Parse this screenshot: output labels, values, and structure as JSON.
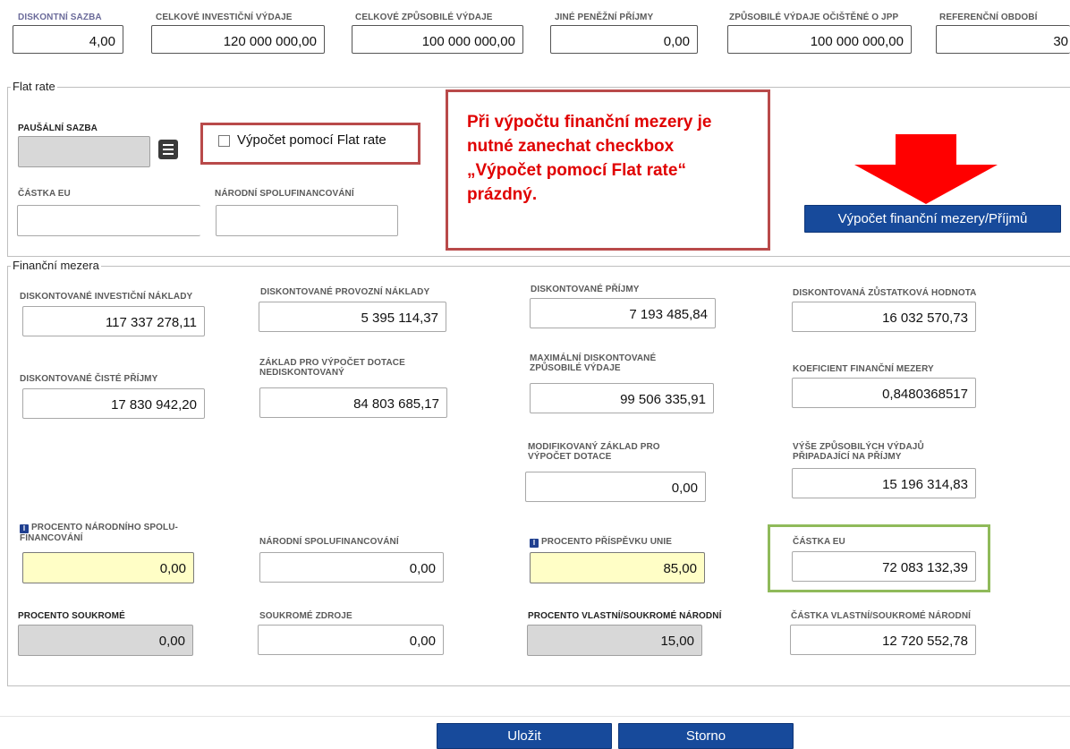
{
  "top": {
    "fields": [
      {
        "label": "DISKONTNÍ SAZBA",
        "value": "4,00"
      },
      {
        "label": "CELKOVÉ INVESTIČNÍ VÝDAJE",
        "value": "120 000 000,00"
      },
      {
        "label": "CELKOVÉ ZPŮSOBILÉ VÝDAJE",
        "value": "100 000 000,00"
      },
      {
        "label": "JINÉ PENĚŽNÍ PŘÍJMY",
        "value": "0,00"
      },
      {
        "label": "ZPŮSOBILÉ VÝDAJE OČIŠTĚNÉ O JPP",
        "value": "100 000 000,00"
      },
      {
        "label": "REFERENČNÍ OBDOBÍ",
        "value": "30"
      }
    ]
  },
  "flat_rate": {
    "title": "Flat rate",
    "pausalni_sazba_label": "PAUŠÁLNÍ SAZBA",
    "pausalni_sazba_value": "",
    "checkbox_label": "Výpočet pomocí Flat rate",
    "castka_eu_label": "ČÁSTKA EU",
    "castka_eu_value": "",
    "narodni_label": "NÁRODNÍ SPOLUFINANCOVÁNÍ",
    "narodni_value": "",
    "calc_button": "Výpočet finanční mezery/Příjmů"
  },
  "annotation": {
    "text": "Při výpočtu finanční mezery je nutné zanechat checkbox „Výpočet pomocí Flat rate“ prázdný.",
    "color": "#e00000",
    "arrow_color": "#ff0000"
  },
  "financni_mezera": {
    "title": "Finanční mezera",
    "disk_invest_label": "DISKONTOVANÉ INVESTIČNÍ NÁKLADY",
    "disk_invest_value": "117 337 278,11",
    "disk_provoz_label": "DISKONTOVANÉ PROVOZNÍ NÁKLADY",
    "disk_provoz_value": "5 395 114,37",
    "disk_prijmy_label": "DISKONTOVANÉ PŘÍJMY",
    "disk_prijmy_value": "7 193 485,84",
    "disk_zustatkova_label": "DISKONTOVANÁ ZŮSTATKOVÁ HODNOTA",
    "disk_zustatkova_value": "16 032 570,73",
    "disk_ciste_label": "DISKONTOVANÉ ČISTÉ PŘÍJMY",
    "disk_ciste_value": "17 830 942,20",
    "zaklad_label": "ZÁKLAD PRO VÝPOČET DOTACE NEDISKONTOVANÝ",
    "zaklad_value": "84 803 685,17",
    "max_label": "MAXIMÁLNÍ DISKONTOVANÉ ZPŮSOBILÉ VÝDAJE",
    "max_value": "99 506 335,91",
    "koef_label": "KOEFICIENT FINANČNÍ MEZERY",
    "koef_value": "0,8480368517",
    "modif_label": "MODIFIKOVANÝ ZÁKLAD PRO VÝPOČET DOTACE",
    "modif_value": "0,00",
    "vyse_label": "VÝŠE ZPŮSOBILÝCH VÝDAJŮ PŘIPADAJÍCÍ NA PŘÍJMY",
    "vyse_value": "15 196 314,83",
    "proc_narodni_label": "PROCENTO NÁRODNÍHO SPOLU-FINANCOVÁNÍ",
    "proc_narodni_value": "0,00",
    "narodni_label": "NÁRODNÍ SPOLUFINANCOVÁNÍ",
    "narodni_value": "0,00",
    "proc_unie_label": "PROCENTO PŘÍSPĚVKU UNIE",
    "proc_unie_value": "85,00",
    "castka_eu_label": "ČÁSTKA EU",
    "castka_eu_value": "72 083 132,39",
    "proc_soukrome_label": "PROCENTO SOUKROMÉ",
    "proc_soukrome_value": "0,00",
    "soukrome_label": "SOUKROMÉ ZDROJE",
    "soukrome_value": "0,00",
    "proc_vlastni_label": "PROCENTO VLASTNÍ/SOUKROMÉ NÁRODNÍ",
    "proc_vlastni_value": "15,00",
    "castka_vlastni_label": "ČÁSTKA VLASTNÍ/SOUKROMÉ NÁRODNÍ",
    "castka_vlastni_value": "12 720 552,78"
  },
  "footer": {
    "save_label": "Uložit",
    "cancel_label": "Storno"
  },
  "colors": {
    "highlight_red": "#b94a4a",
    "highlight_green": "#8fba5a",
    "button_blue": "#174a9b"
  }
}
